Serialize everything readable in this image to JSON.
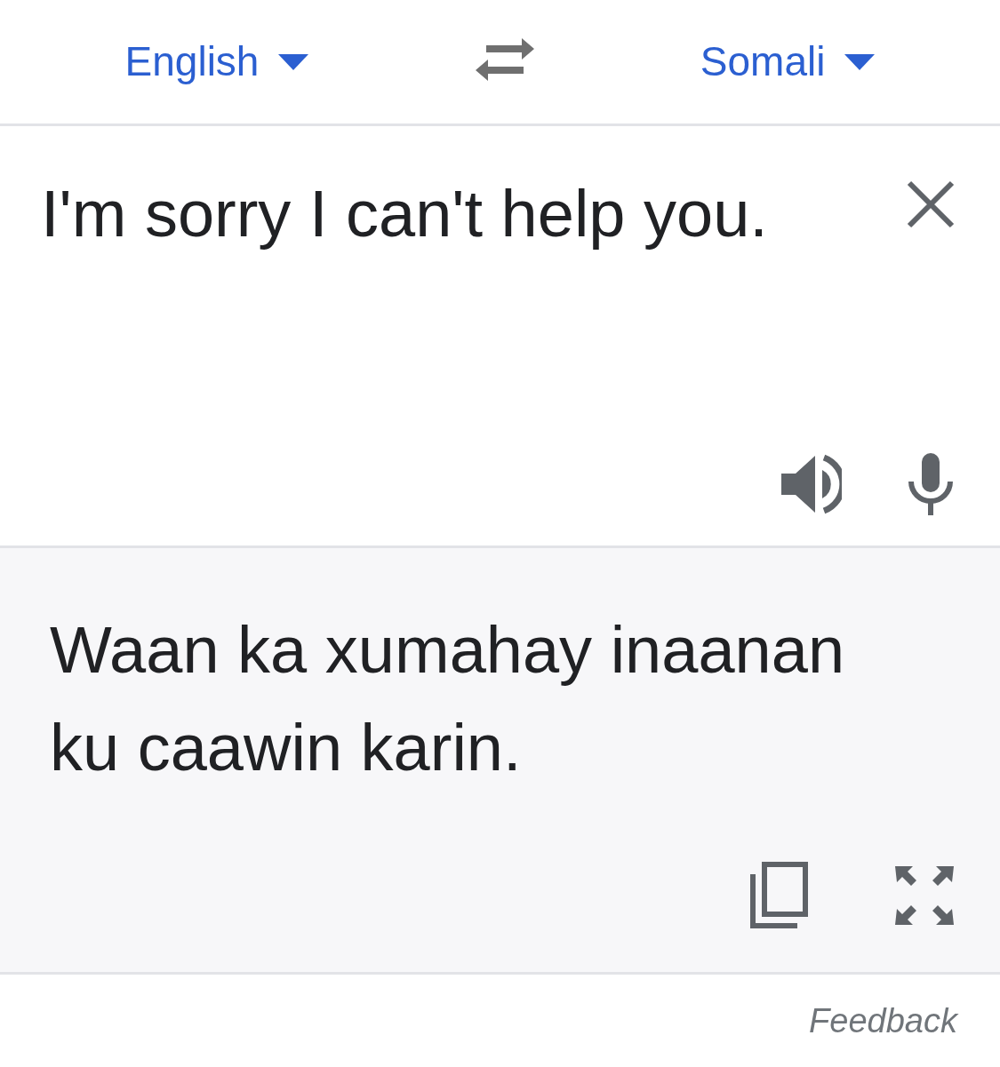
{
  "source_language": {
    "label": "English"
  },
  "target_language": {
    "label": "Somali"
  },
  "input": {
    "text": "I'm sorry I can't help you."
  },
  "output": {
    "text": "Waan ka xumahay inaanan ku caawin karin."
  },
  "footer": {
    "link": "Feedback"
  }
}
